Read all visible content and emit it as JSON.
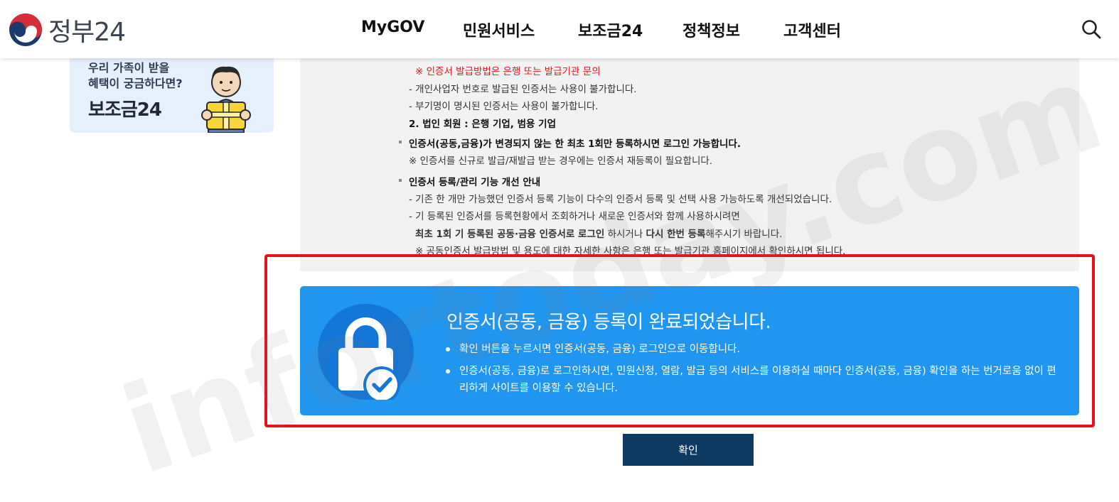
{
  "header": {
    "logo_text": "정부24",
    "nav": [
      "MyGOV",
      "민원서비스",
      "보조금24",
      "정책정보",
      "고객센터"
    ]
  },
  "side_banner": {
    "line1": "우리 가족이 받을",
    "line2": "혜택이 궁금하다면?",
    "title": "보조금24"
  },
  "info": {
    "red_note": "※ 인증서 발급방법은 은행 또는 발급기관 문의",
    "line1": "- 개인사업자 번호로 발급된 인증서는 사용이 불가합니다.",
    "line2": "- 부기명이 명시된 인증서는 사용이 불가합니다.",
    "corp_title": "2. 법인 회원 : 은행 기업, 범용 기업",
    "bullet1_title": "인증서(공동,금융)가 변경되지 않는 한 최초 1회만 등록하시면 로그인 가능합니다.",
    "bullet1_note": "※ 인증서를 신규로 발급/재발급 받는 경우에는 인증서 재등록이 필요합니다.",
    "bullet2_title": "인증서 등록/관리 기능 개선 안내",
    "bullet2_line1": "- 기존 한 개만 가능했던 인증서 등록 기능이 다수의 인증서 등록 및 선택 사용 가능하도록 개선되었습니다.",
    "bullet2_line2": "- 기 등록된 인증서를 등록현황에서 조회하거나 새로운 인증서와 함께 사용하시려면",
    "bullet2_line3_a": "최초 1회 기 등록된 공동·금융 인증서로 로그인",
    "bullet2_line3_b": " 하시거나 ",
    "bullet2_line3_c": "다시 한번 등록",
    "bullet2_line3_d": "해주시기 바랍니다.",
    "bullet2_note": "※ 공동인증서 발급방법 및 용도에 대한 자세한 사항은 은행 또는 발급기관 홈페이지에서 확인하시면 됩니다."
  },
  "done": {
    "title": "인증서(공동, 금융) 등록이 완료되었습니다.",
    "item1": "확인 버튼을 누르시면 인증서(공동, 금융) 로그인으로 이동합니다.",
    "item2": "인증서(공동, 금융)로 로그인하시면, 민원신청, 열람, 발급 등의 서비스를 이용하실 때마다 인증서(공동, 금융) 확인을 하는 번거로움 없이 편리하게 사이트를 이용할 수 있습니다."
  },
  "confirm_label": "확인",
  "watermark": "infortoday.com",
  "colors": {
    "panel_blue": "#2196f0",
    "button_navy": "#0f3a62",
    "highlight_red": "#e8101a",
    "note_red": "#e0161e"
  }
}
